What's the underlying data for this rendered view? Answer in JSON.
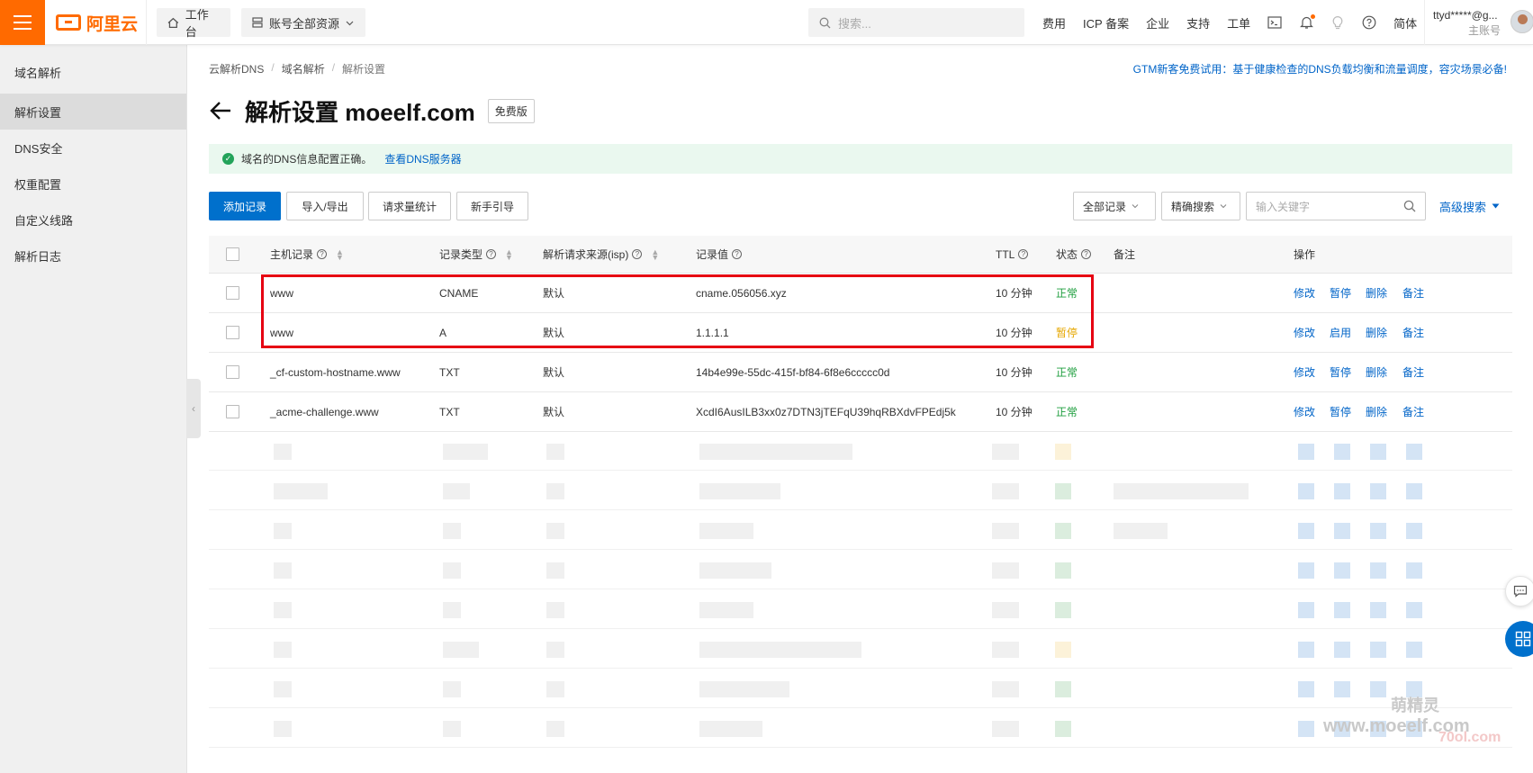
{
  "topbar": {
    "logo_text": "阿里云",
    "workbench": "工作台",
    "resources": "账号全部资源",
    "search_placeholder": "搜索...",
    "links": [
      "费用",
      "ICP 备案",
      "企业",
      "支持",
      "工单"
    ],
    "lang": "简体",
    "account_name": "ttyd*****@g...",
    "account_role": "主账号"
  },
  "sidebar": {
    "items": [
      "域名解析",
      "解析设置",
      "DNS安全",
      "权重配置",
      "自定义线路",
      "解析日志"
    ],
    "active_index": 1
  },
  "breadcrumb": [
    "云解析DNS",
    "域名解析",
    "解析设置"
  ],
  "promo": "GTM新客免费试用：基于健康检查的DNS负载均衡和流量调度，容灾场景必备!",
  "page": {
    "title": "解析设置 moeelf.com",
    "edition_badge": "免费版"
  },
  "alert": {
    "text": "域名的DNS信息配置正确。",
    "link": "查看DNS服务器"
  },
  "toolbar": {
    "add": "添加记录",
    "import_export": "导入/导出",
    "stats": "请求量统计",
    "guide": "新手引导",
    "filter_all": "全部记录",
    "exact_search": "精确搜索",
    "keyword_placeholder": "输入关键字",
    "advanced": "高级搜索"
  },
  "table": {
    "headers": {
      "host": "主机记录",
      "type": "记录类型",
      "line": "解析请求来源(isp)",
      "value": "记录值",
      "ttl": "TTL",
      "status": "状态",
      "remark": "备注",
      "actions": "操作"
    },
    "rows": [
      {
        "host": "www",
        "type": "CNAME",
        "line": "默认",
        "value": "cname.056056.xyz",
        "ttl": "10 分钟",
        "status": "正常",
        "actions": [
          "修改",
          "暂停",
          "删除",
          "备注"
        ]
      },
      {
        "host": "www",
        "type": "A",
        "line": "默认",
        "value": "1.1.1.1",
        "ttl": "10 分钟",
        "status": "暂停",
        "actions": [
          "修改",
          "启用",
          "删除",
          "备注"
        ]
      },
      {
        "host": "_cf-custom-hostname.www",
        "type": "TXT",
        "line": "默认",
        "value": "14b4e99e-55dc-415f-bf84-6f8e6ccccc0d",
        "ttl": "10 分钟",
        "status": "正常",
        "actions": [
          "修改",
          "暂停",
          "删除",
          "备注"
        ]
      },
      {
        "host": "_acme-challenge.www",
        "type": "TXT",
        "line": "默认",
        "value": "XcdI6AusILB3xx0z7DTN3jTEFqU39hqRBXdvFPEdj5k",
        "ttl": "10 分钟",
        "status": "正常",
        "actions": [
          "修改",
          "暂停",
          "删除",
          "备注"
        ]
      }
    ]
  },
  "watermark": {
    "line1": "萌精灵",
    "line2": "www.moeelf.com",
    "line3": "70ol.com"
  },
  "colors": {
    "brand": "#ff6a00",
    "primary": "#0070cc",
    "ok": "#1e9e3e",
    "paused": "#e6a700",
    "highlight": "#e60012"
  }
}
